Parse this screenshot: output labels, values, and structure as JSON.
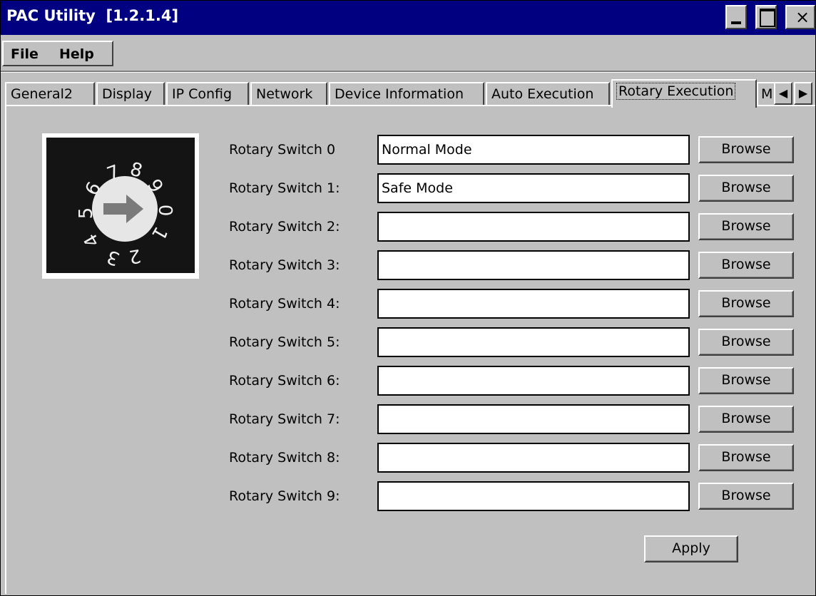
{
  "window": {
    "title": "PAC Utility  [1.2.1.4]",
    "close_glyph": "×"
  },
  "menu": {
    "file": "File",
    "help": "Help"
  },
  "tabs": [
    {
      "label": "General2"
    },
    {
      "label": "Display"
    },
    {
      "label": "IP Config"
    },
    {
      "label": "Network"
    },
    {
      "label": "Device Information"
    },
    {
      "label": "Auto Execution"
    },
    {
      "label": "Rotary Execution"
    },
    {
      "label": "M"
    }
  ],
  "tab_scroll": {
    "left": "◀",
    "right": "▶"
  },
  "rotary_image": {
    "digits": [
      "0",
      "1",
      "2",
      "3",
      "4",
      "5",
      "6",
      "7",
      "8",
      "9"
    ]
  },
  "rows": [
    {
      "label": "Rotary Switch 0",
      "value": "Normal Mode",
      "button": "Browse"
    },
    {
      "label": "Rotary Switch 1:",
      "value": "Safe Mode",
      "button": "Browse"
    },
    {
      "label": "Rotary Switch 2:",
      "value": "",
      "button": "Browse"
    },
    {
      "label": "Rotary Switch 3:",
      "value": "",
      "button": "Browse"
    },
    {
      "label": "Rotary Switch 4:",
      "value": "",
      "button": "Browse"
    },
    {
      "label": "Rotary Switch 5:",
      "value": "",
      "button": "Browse"
    },
    {
      "label": "Rotary Switch 6:",
      "value": "",
      "button": "Browse"
    },
    {
      "label": "Rotary Switch 7:",
      "value": "",
      "button": "Browse"
    },
    {
      "label": "Rotary Switch 8:",
      "value": "",
      "button": "Browse"
    },
    {
      "label": "Rotary Switch 9:",
      "value": "",
      "button": "Browse"
    }
  ],
  "apply_label": "Apply",
  "colors": {
    "title_bar": "#000080",
    "face": "#c0c0c0"
  }
}
